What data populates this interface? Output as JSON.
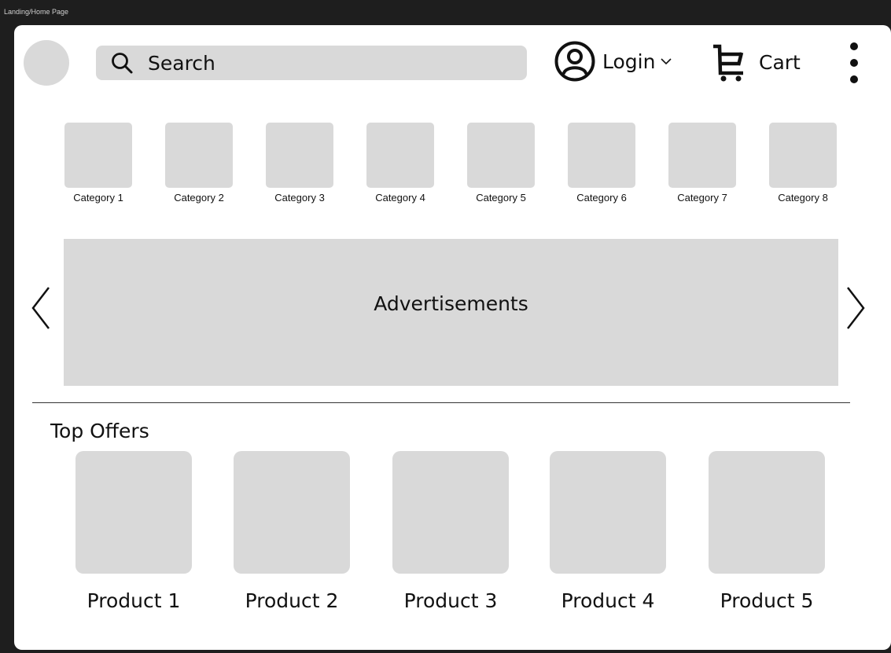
{
  "frame_label": "Landing/Home Page",
  "header": {
    "search_placeholder": "Search",
    "login_label": "Login",
    "cart_label": "Cart"
  },
  "icons": {
    "search": "search-icon",
    "user": "user-circle-icon",
    "chevron": "chevron-down-icon",
    "cart": "cart-icon",
    "menu": "kebab-menu-icon",
    "prev": "chevron-left-icon",
    "next": "chevron-right-icon"
  },
  "categories": [
    {
      "label": "Category 1"
    },
    {
      "label": "Category 2"
    },
    {
      "label": "Category 3"
    },
    {
      "label": "Category 4"
    },
    {
      "label": "Category 5"
    },
    {
      "label": "Category 6"
    },
    {
      "label": "Category 7"
    },
    {
      "label": "Category 8"
    }
  ],
  "banner": {
    "label": "Advertisements"
  },
  "top_offers": {
    "title": "Top Offers",
    "products": [
      {
        "label": "Product 1"
      },
      {
        "label": "Product 2"
      },
      {
        "label": "Product 3"
      },
      {
        "label": "Product 4"
      },
      {
        "label": "Product 5"
      }
    ]
  },
  "colors": {
    "canvas": "#1e1e1e",
    "surface": "#ffffff",
    "placeholder": "#d9d9d9",
    "text": "#111111"
  }
}
